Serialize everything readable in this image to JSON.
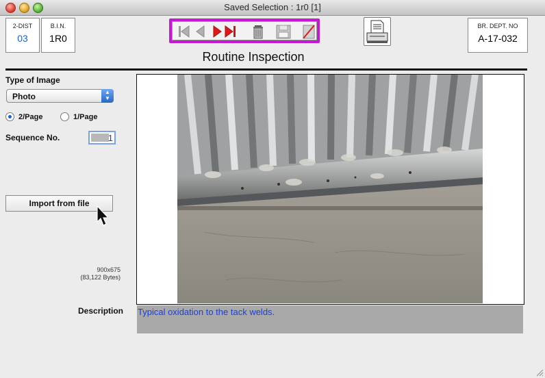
{
  "window": {
    "title": "Saved Selection : 1r0 [1]"
  },
  "header": {
    "dist_label": "2-DIST",
    "dist_value": "03",
    "bin_label": "B.I.N.",
    "bin_value": "1R0",
    "brdept_label": "BR. DEPT. NO",
    "brdept_value": "A-17-032",
    "title": "Routine Inspection"
  },
  "colors": {
    "nav_highlight": "#c31ad1",
    "link_blue": "#1a3fd8",
    "record_value": "#1c5fd4"
  },
  "form": {
    "type_label": "Type of Image",
    "type_value": "Photo",
    "radio_2page": "2/Page",
    "radio_1page": "1/Page",
    "selected_layout": "2/Page",
    "sequence_label": "Sequence No.",
    "sequence_value": "1",
    "import_button": "Import from file",
    "image_dimensions": "900x675",
    "image_size": "(83,122 Bytes)",
    "description_label": "Description",
    "description_value": "Typical oxidation to the tack welds."
  },
  "icons": [
    "first-record-icon",
    "previous-record-icon",
    "next-record-icon",
    "last-record-icon",
    "trash-icon",
    "save-disk-icon",
    "cancel-edit-icon",
    "print-icon",
    "pointer-cursor-icon",
    "resize-grip-icon"
  ]
}
